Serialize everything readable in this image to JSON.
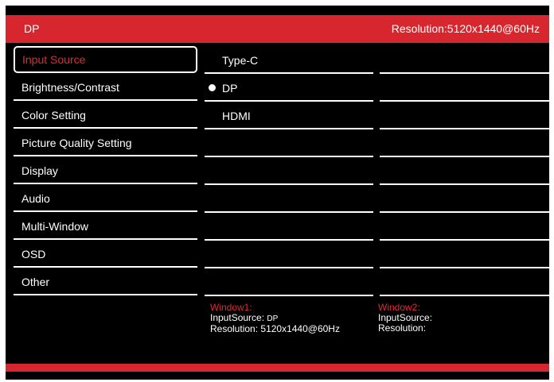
{
  "header": {
    "source": "DP",
    "resolution": "Resolution:5120x1440@60Hz"
  },
  "menu": {
    "items": [
      {
        "label": "Input Source"
      },
      {
        "label": "Brightness/Contrast"
      },
      {
        "label": "Color Setting"
      },
      {
        "label": "Picture Quality Setting"
      },
      {
        "label": "Display"
      },
      {
        "label": "Audio"
      },
      {
        "label": "Multi-Window"
      },
      {
        "label": "OSD"
      },
      {
        "label": "Other"
      }
    ],
    "selected_index": 0
  },
  "input_options": [
    {
      "label": "Type-C"
    },
    {
      "label": "DP"
    },
    {
      "label": "HDMI"
    }
  ],
  "selected_input": "DP",
  "windows": {
    "w1": {
      "title": "Window1:",
      "input_label": "InputSource:",
      "input_value": "DP",
      "res_label": "Resolution:",
      "res_value": "5120x1440@60Hz"
    },
    "w2": {
      "title": "Window2:",
      "input_label": "InputSource:",
      "res_label": "Resolution:"
    }
  },
  "colors": {
    "accent": "#d7262d",
    "background": "#000000",
    "text": "#ffffff"
  }
}
